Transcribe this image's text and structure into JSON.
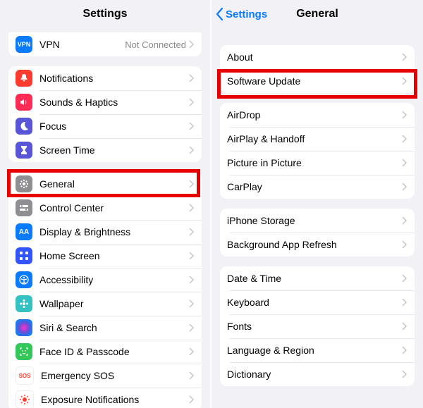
{
  "left": {
    "title": "Settings",
    "vpn": {
      "label": "VPN",
      "status": "Not Connected",
      "icon_bg": "#0a7aff"
    },
    "group2": [
      {
        "label": "Notifications",
        "icon_bg": "#ff3b30",
        "icon": "bell"
      },
      {
        "label": "Sounds & Haptics",
        "icon_bg": "#ff2d55",
        "icon": "sound"
      },
      {
        "label": "Focus",
        "icon_bg": "#5856d6",
        "icon": "moon"
      },
      {
        "label": "Screen Time",
        "icon_bg": "#5856d6",
        "icon": "hourglass"
      }
    ],
    "group3": [
      {
        "label": "General",
        "icon_bg": "#8e8e93",
        "icon": "gear"
      },
      {
        "label": "Control Center",
        "icon_bg": "#8e8e93",
        "icon": "switches"
      },
      {
        "label": "Display & Brightness",
        "icon_bg": "#0a7aff",
        "icon": "AA"
      },
      {
        "label": "Home Screen",
        "icon_bg": "#3355ff",
        "icon": "grid"
      },
      {
        "label": "Accessibility",
        "icon_bg": "#0a7aff",
        "icon": "person"
      },
      {
        "label": "Wallpaper",
        "icon_bg": "#34c1c1",
        "icon": "flower"
      },
      {
        "label": "Siri & Search",
        "icon_bg": "#1c1c1e",
        "icon": "siri"
      },
      {
        "label": "Face ID & Passcode",
        "icon_bg": "#34c759",
        "icon": "face"
      },
      {
        "label": "Emergency SOS",
        "icon_bg": "#ffffff",
        "icon": "SOS"
      },
      {
        "label": "Exposure Notifications",
        "icon_bg": "#ffffff",
        "icon": "covid"
      }
    ]
  },
  "right": {
    "back": "Settings",
    "title": "General",
    "group1": [
      {
        "label": "About"
      },
      {
        "label": "Software Update"
      }
    ],
    "group2": [
      {
        "label": "AirDrop"
      },
      {
        "label": "AirPlay & Handoff"
      },
      {
        "label": "Picture in Picture"
      },
      {
        "label": "CarPlay"
      }
    ],
    "group3": [
      {
        "label": "iPhone Storage"
      },
      {
        "label": "Background App Refresh"
      }
    ],
    "group4": [
      {
        "label": "Date & Time"
      },
      {
        "label": "Keyboard"
      },
      {
        "label": "Fonts"
      },
      {
        "label": "Language & Region"
      },
      {
        "label": "Dictionary"
      }
    ]
  }
}
